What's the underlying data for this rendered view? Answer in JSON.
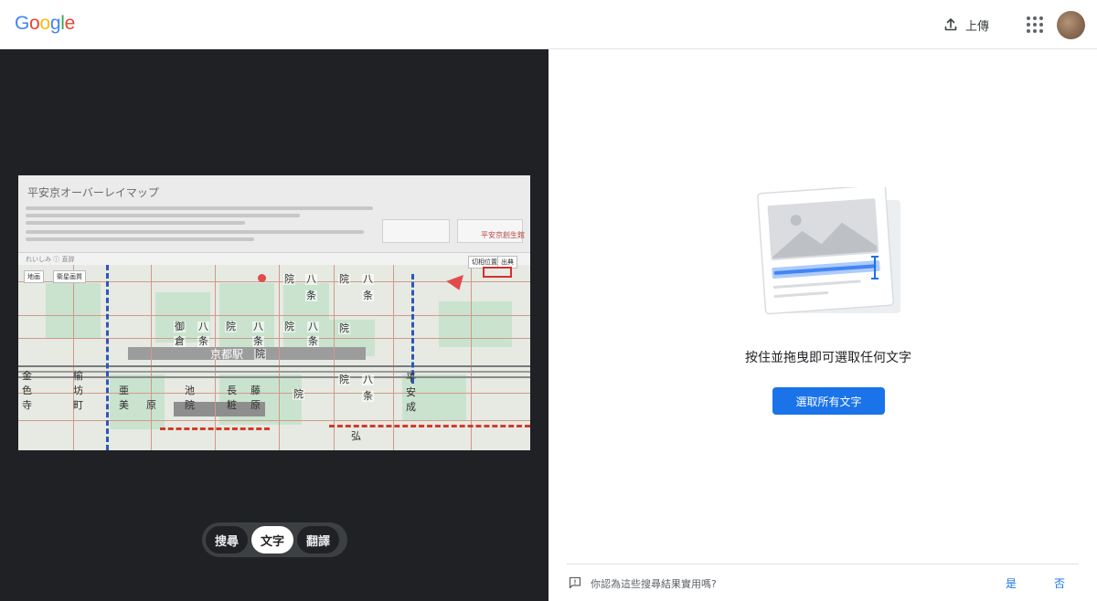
{
  "header": {
    "logo_letters": [
      {
        "ch": "G",
        "color": "#4285F4"
      },
      {
        "ch": "o",
        "color": "#EA4335"
      },
      {
        "ch": "o",
        "color": "#FBBC05"
      },
      {
        "ch": "g",
        "color": "#4285F4"
      },
      {
        "ch": "l",
        "color": "#34A853"
      },
      {
        "ch": "e",
        "color": "#EA4335"
      }
    ],
    "upload_label": "上傳",
    "upload_icon": "upload-icon",
    "apps_icon": "apps-grid-icon"
  },
  "preview": {
    "map_title": "平安京オーバーレイマップ",
    "brand_label": "平安京創生館",
    "tabs_text": "れいしみ  ⓘ 直辞",
    "kanji_labels": [
      "八",
      "条",
      "院",
      "八",
      "条",
      "院",
      "八",
      "条",
      "御",
      "倉",
      "八",
      "条",
      "院",
      "八",
      "条",
      "院",
      "八",
      "条",
      "京都駅",
      "院",
      "亜",
      "美",
      "原",
      "池",
      "院",
      "長",
      "粧",
      "藤",
      "原",
      "院",
      "院",
      "八",
      "条",
      "平",
      "安",
      "成",
      "金",
      "色",
      "寺",
      "榆",
      "坊",
      "町",
      "院",
      "弘"
    ],
    "map_buttons": [
      "地画",
      "衛星画質",
      "切相位置",
      "出典"
    ]
  },
  "modes": {
    "items": [
      {
        "label": "搜尋",
        "active": false
      },
      {
        "label": "文字",
        "active": true
      },
      {
        "label": "翻譯",
        "active": false
      }
    ]
  },
  "panel": {
    "hint": "按住並拖曳即可選取任何文字",
    "select_all_label": "選取所有文字"
  },
  "feedback": {
    "question": "你認為這些搜尋結果實用嗎?",
    "yes_label": "是",
    "no_label": "否"
  },
  "colors": {
    "accent": "#1a73e8",
    "dark_bg": "#202124",
    "toggle_bg": "#3c4043"
  }
}
